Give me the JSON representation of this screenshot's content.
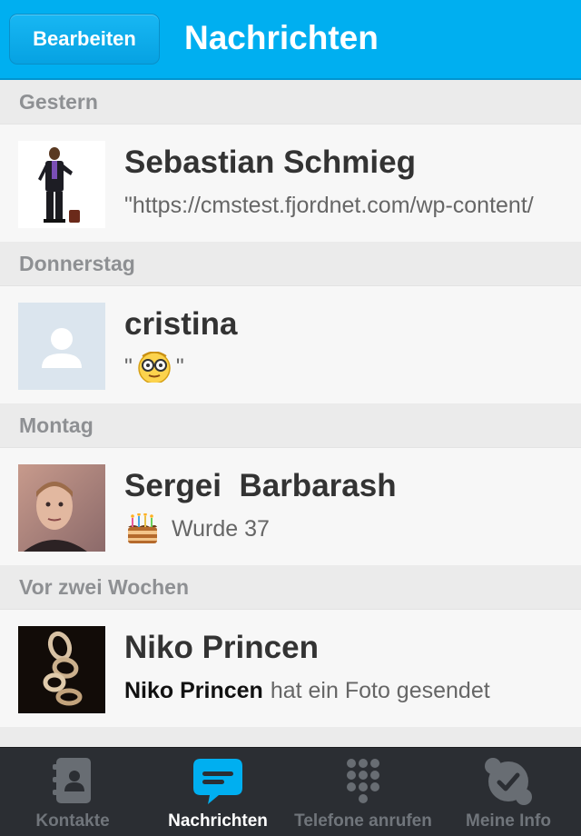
{
  "navbar": {
    "edit_label": "Bearbeiten",
    "title": "Nachrichten"
  },
  "sections": [
    {
      "header": "Gestern",
      "name": "Sebastian Schmieg",
      "preview": "\"https://cmstest.fjordnet.com/wp-content/",
      "avatar": "person-suit-photo"
    },
    {
      "header": "Donnerstag",
      "name": "cristina",
      "preview_prefix": "\"",
      "preview_emoji": "nerd-face-emoticon",
      "preview_suffix": "\"",
      "avatar": "default-avatar"
    },
    {
      "header": "Montag",
      "name": "Sergei  Barbarash",
      "preview": "Wurde 37",
      "preview_icon": "birthday-cake-icon",
      "avatar": "face-photo"
    },
    {
      "header": "Vor zwei Wochen",
      "name": "Niko Princen",
      "preview_bold": "Niko Princen",
      "preview": "hat ein Foto gesendet",
      "avatar": "sculpture-photo"
    }
  ],
  "tabs": [
    {
      "label": "Kontakte",
      "icon": "contacts-book-icon",
      "active": false
    },
    {
      "label": "Nachrichten",
      "icon": "chat-bubble-icon",
      "active": true
    },
    {
      "label": "Telefone anrufen",
      "icon": "dialpad-icon",
      "active": false
    },
    {
      "label": "Meine Info",
      "icon": "skype-check-icon",
      "active": false
    }
  ],
  "colors": {
    "accent": "#00aff0",
    "tabbar": "#2b2e33",
    "header_bg": "#ebebeb"
  }
}
